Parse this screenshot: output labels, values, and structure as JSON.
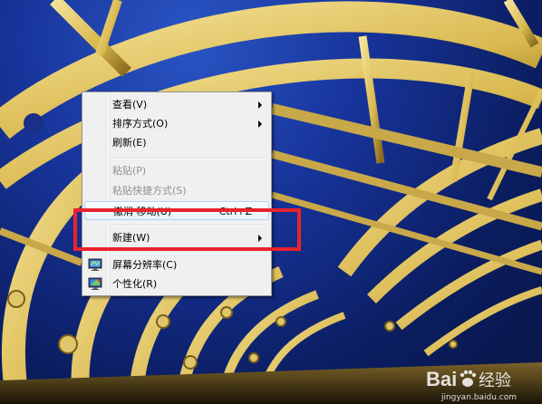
{
  "context_menu": {
    "items": [
      {
        "label": "查看(V)",
        "enabled": true,
        "submenu": true
      },
      {
        "label": "排序方式(O)",
        "enabled": true,
        "submenu": true
      },
      {
        "label": "刷新(E)",
        "enabled": true,
        "submenu": false
      },
      {
        "label": "粘贴(P)",
        "enabled": false,
        "submenu": false
      },
      {
        "label": "粘贴快捷方式(S)",
        "enabled": false,
        "submenu": false
      },
      {
        "label": "撤消 移动(U)",
        "shortcut": "Ctrl+Z",
        "enabled": true,
        "submenu": false
      },
      {
        "label": "新建(W)",
        "enabled": true,
        "submenu": true
      },
      {
        "label": "屏幕分辨率(C)",
        "enabled": true,
        "submenu": false,
        "icon": "display-resolution-icon"
      },
      {
        "label": "个性化(R)",
        "enabled": true,
        "submenu": false,
        "icon": "personalize-icon"
      }
    ]
  },
  "annotation": {
    "highlight_color": "#e8232b"
  },
  "watermark": {
    "brand": "Bai",
    "brand_suffix": "经验",
    "url": "jingyan.baidu.com"
  },
  "colors": {
    "sky": "#17349a",
    "structure": "#e8cf7a",
    "menu_bg": "#f0f0f0",
    "hover_border": "#b4d3f3"
  }
}
